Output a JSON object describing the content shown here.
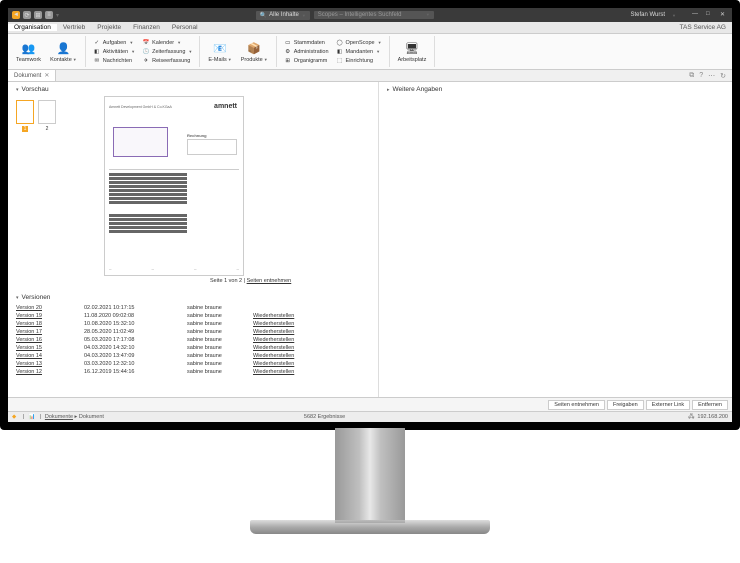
{
  "titlebar": {
    "search_filter": "Alle Inhalte",
    "search_placeholder": "Scopes – Intelligentes Suchfeld",
    "user": "Stefan Wurst"
  },
  "menu": {
    "items": [
      "Organisation",
      "Vertrieb",
      "Projekte",
      "Finanzen",
      "Personal"
    ],
    "right": "TAS Service AG"
  },
  "ribbon": {
    "teamwork": "Teamwork",
    "kontakte": "Kontakte",
    "aufgaben": "Aufgaben",
    "aktivitaten": "Aktivitäten",
    "nachrichten": "Nachrichten",
    "kalender": "Kalender",
    "zeiterfassung": "Zeiterfassung",
    "reiseerfassung": "Reiseerfassung",
    "emails": "E-Mails",
    "produkte": "Produkte",
    "stammdaten": "Stammdaten",
    "administration": "Administration",
    "organigramm": "Organigramm",
    "openscope": "OpenScope",
    "mandanten": "Mandanten",
    "einrichtung": "Einrichtung",
    "arbeitsplatz": "Arbeitsplatz"
  },
  "tabs": {
    "t1": "Dokument"
  },
  "preview": {
    "header": "Vorschau",
    "thumb1": "1",
    "thumb2": "2",
    "logo": "amnett",
    "doc_title": "Rechnung",
    "doc_header": "Amnett Development\nGmbH & Co.KGaA",
    "page_info_prefix": "Seite 1 von 2 | ",
    "page_info_link": "Seiten entnehmen"
  },
  "side": {
    "header": "Weitere Angaben"
  },
  "versions": {
    "header": "Versionen",
    "rows": [
      {
        "name": "Version 20",
        "date": "02.02.2021 10:17:15",
        "user": "sabine braune",
        "action": ""
      },
      {
        "name": "Version 19",
        "date": "11.08.2020 09:02:08",
        "user": "sabine braune",
        "action": "Wiederherstellen"
      },
      {
        "name": "Version 18",
        "date": "10.08.2020 15:32:10",
        "user": "sabine braune",
        "action": "Wiederherstellen"
      },
      {
        "name": "Version 17",
        "date": "28.05.2020 11:02:49",
        "user": "sabine braune",
        "action": "Wiederherstellen"
      },
      {
        "name": "Version 16",
        "date": "05.03.2020 17:17:08",
        "user": "sabine braune",
        "action": "Wiederherstellen"
      },
      {
        "name": "Version 15",
        "date": "04.03.2020 14:32:10",
        "user": "sabine braune",
        "action": "Wiederherstellen"
      },
      {
        "name": "Version 14",
        "date": "04.03.2020 13:47:09",
        "user": "sabine braune",
        "action": "Wiederherstellen"
      },
      {
        "name": "Version 13",
        "date": "03.03.2020 12:32:10",
        "user": "sabine braune",
        "action": "Wiederherstellen"
      },
      {
        "name": "Version 12",
        "date": "16.12.2019 15:44:16",
        "user": "sabine braune",
        "action": "Wiederherstellen"
      }
    ]
  },
  "actions": {
    "b1": "Seiten entnehmen",
    "b2": "Freigaben",
    "b3": "Externer Link",
    "b4": "Entfernen"
  },
  "status": {
    "breadcrumb_root": "Dokumente",
    "breadcrumb_item": "Dokument",
    "results": "5682 Ergebnisse",
    "coords": "192.168.200"
  }
}
